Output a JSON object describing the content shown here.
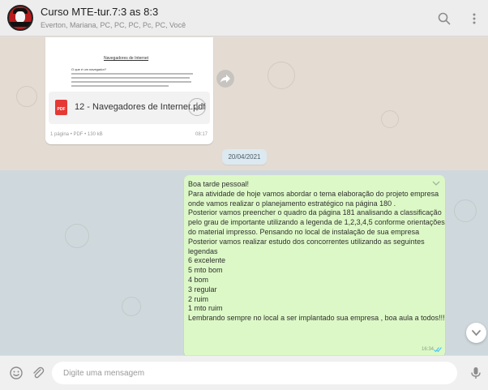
{
  "header": {
    "title": "Curso MTE-tur.7:3 as 8:3",
    "subtitle": "Everton, Mariana, PC, PC, PC, Pc, PC, Você",
    "search_icon": "search-icon",
    "menu_icon": "more-vertical-icon"
  },
  "document_message": {
    "preview_heading": "Navegadores de Internet",
    "preview_question": "O que é um navegador?",
    "file_name": "12 - Navegadores de Internet.pdf",
    "file_type_badge": "PDF",
    "meta": "1 página • PDF • 130 kB",
    "time": "08:17",
    "forward_icon": "forward-icon",
    "download_icon": "download-icon"
  },
  "date_separator": "20/04/2021",
  "text_message": {
    "lines": [
      "Boa tarde pessoal!",
      "Para atividade de hoje vamos abordar o tema elaboração do projeto empresa",
      "onde vamos realizar o planejamento estratégico na página 180 .",
      "Posterior vamos preencher o quadro da página 181 analisando a classificação",
      "pelo grau de importante utilizando a legenda de 1,2,3,4,5 conforme orientações",
      "do material impresso. Pensando no local de instalação de sua empresa",
      "Posterior vamos realizar estudo dos concorrentes utilizando as seguintes",
      "legendas",
      "6 excelente",
      "5 mto bom",
      "4 bom",
      "3 regular",
      "2 ruim",
      "1 mto ruim",
      "Lembrando sempre no local a ser implantado sua empresa , boa aula a todos!!!"
    ],
    "time": "16:34",
    "status_icon": "double-check-icon",
    "menu_icon": "chevron-down-icon"
  },
  "composer": {
    "placeholder": "Digite uma mensagem",
    "emoji_icon": "emoji-icon",
    "attach_icon": "paperclip-icon",
    "mic_icon": "microphone-icon"
  },
  "colors": {
    "outgoing_bubble": "#dcf8c6",
    "incoming_bubble": "#ffffff",
    "header_bg": "#ededed",
    "read_check": "#4fc3f7",
    "pdf_red": "#e53935"
  }
}
